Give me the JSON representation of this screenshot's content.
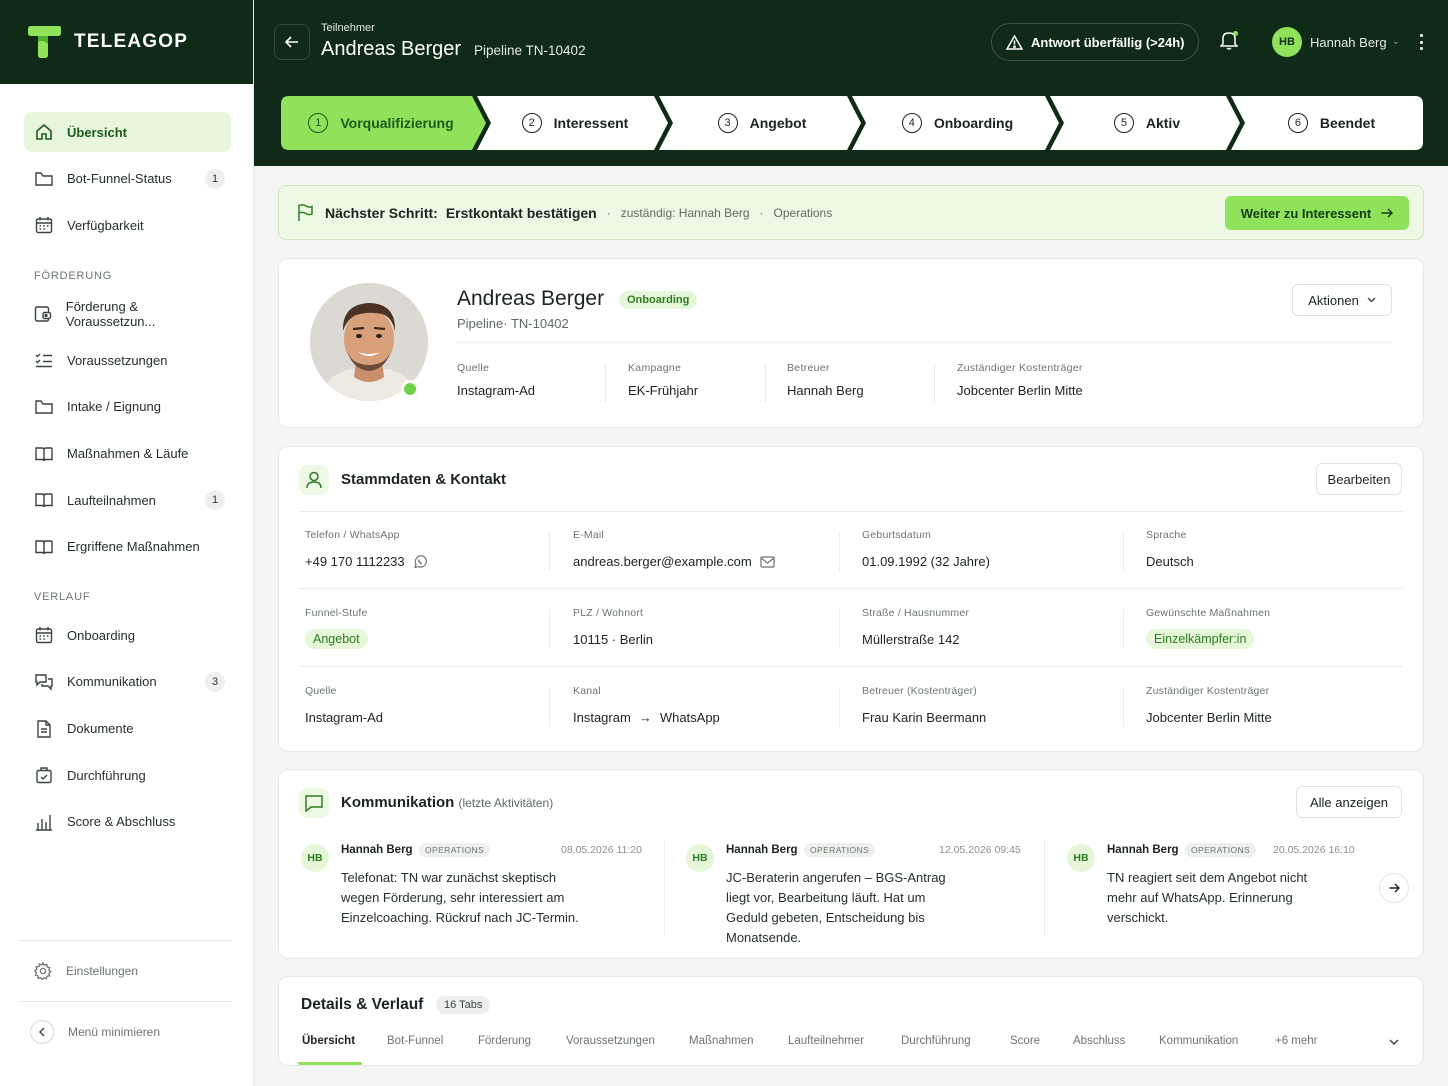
{
  "brand": {
    "name": "TELEAGOP"
  },
  "sidebar": {
    "items": [
      {
        "label": "Übersicht",
        "icon": "home-icon",
        "active": true
      },
      {
        "label": "Bot-Funnel-Status",
        "icon": "folder-icon",
        "count": "1"
      },
      {
        "label": "Verfügbarkeit",
        "icon": "calendar-icon"
      }
    ],
    "section_foerderung": "FÖRDERUNG",
    "foerderung_items": [
      {
        "label": "Förderung & Voraussetzun...",
        "icon": "wallet-icon"
      },
      {
        "label": "Voraussetzungen",
        "icon": "checklist-icon"
      },
      {
        "label": "Intake / Eignung",
        "icon": "folder-icon"
      },
      {
        "label": "Maßnahmen & Läufe",
        "icon": "book-icon"
      },
      {
        "label": "Laufteilnahmen",
        "icon": "book-icon",
        "count": "1"
      },
      {
        "label": "Ergriffene Maßnahmen",
        "icon": "book-icon"
      }
    ],
    "section_verlauf": "VERLAUF",
    "verlauf_items": [
      {
        "label": "Onboarding",
        "icon": "calendar-icon"
      },
      {
        "label": "Kommunikation",
        "icon": "chat-icon",
        "count": "3"
      },
      {
        "label": "Dokumente",
        "icon": "document-icon"
      },
      {
        "label": "Durchführung",
        "icon": "briefcase-icon"
      },
      {
        "label": "Score & Abschluss",
        "icon": "bar-chart-icon"
      }
    ],
    "settings": "Einstellungen",
    "minimize": "Menü minimieren"
  },
  "header": {
    "small_label": "Teilnehmer",
    "name": "Andreas Berger",
    "pipeline": "Pipeline TN-10402",
    "alert": "Antwort überfällig (>24h)",
    "user_initials": "HB",
    "user_name": "Hannah Berg"
  },
  "stepper": [
    {
      "num": "1",
      "label": "Vorqualifizierung",
      "active": true
    },
    {
      "num": "2",
      "label": "Interessent"
    },
    {
      "num": "3",
      "label": "Angebot"
    },
    {
      "num": "4",
      "label": "Onboarding"
    },
    {
      "num": "5",
      "label": "Aktiv"
    },
    {
      "num": "6",
      "label": "Beendet"
    }
  ],
  "next_step": {
    "label": "Nächster Schritt:",
    "value": "Erstkontakt bestätigen",
    "owner": "zuständig: Hannah Berg",
    "team": "Operations",
    "button": "Weiter zu Interessent"
  },
  "profile": {
    "name": "Andreas Berger",
    "badge": "Onboarding",
    "pipeline": "Pipeline· TN-10402",
    "actions": "Aktionen",
    "fields": [
      {
        "key": "Quelle",
        "value": "Instagram-Ad"
      },
      {
        "key": "Kampagne",
        "value": "EK-Frühjahr"
      },
      {
        "key": "Betreuer",
        "value": "Hannah Berg"
      },
      {
        "key": "Zuständiger Kostenträger",
        "value": "Jobcenter Berlin Mitte"
      }
    ]
  },
  "stammdaten": {
    "title": "Stammdaten & Kontakt",
    "edit": "Bearbeiten",
    "rows": [
      [
        {
          "key": "Telefon / WhatsApp",
          "value": "+49 170 1112233"
        },
        {
          "key": "E-Mail",
          "value": "andreas.berger@example.com"
        },
        {
          "key": "Geburtsdatum",
          "value": "01.09.1992 (32 Jahre)"
        },
        {
          "key": "Sprache",
          "value": "Deutsch"
        }
      ],
      [
        {
          "key": "Funnel-Stufe",
          "value": "Angebot"
        },
        {
          "key": "PLZ / Wohnort",
          "value": "10115 · Berlin"
        },
        {
          "key": "Straße / Hausnummer",
          "value": "Müllerstraße 142"
        },
        {
          "key": "Gewünschte Maßnahmen",
          "value": "Einzelkämpfer:in"
        }
      ],
      [
        {
          "key": "Quelle",
          "value": "Instagram-Ad"
        },
        {
          "key": "Kanal",
          "value_from": "Instagram",
          "value_arrow": "→",
          "value_to": "WhatsApp"
        },
        {
          "key": "Betreuer (Kostenträger)",
          "value": "Frau Karin Beermann"
        },
        {
          "key": "Zuständiger Kostenträger",
          "value": "Jobcenter Berlin Mitte"
        }
      ]
    ]
  },
  "kommunikation": {
    "title": "Kommunikation",
    "subtitle": "(letzte Aktivitäten)",
    "show_all": "Alle anzeigen",
    "messages": [
      {
        "initials": "HB",
        "name": "Hannah Berg",
        "tag": "OPERATIONS",
        "time": "08.05.2026 11:20",
        "text": "Telefonat: TN war zunächst skeptisch wegen Förderung, sehr interessiert am Einzelcoaching. Rückruf nach JC-Termin."
      },
      {
        "initials": "HB",
        "name": "Hannah Berg",
        "tag": "OPERATIONS",
        "time": "12.05.2026 09:45",
        "text": "JC-Beraterin angerufen – BGS-Antrag liegt vor, Bearbeitung läuft. Hat um Geduld gebeten, Entscheidung bis Monatsende."
      },
      {
        "initials": "HB",
        "name": "Hannah Berg",
        "tag": "OPERATIONS",
        "time": "20.05.2026 16:10",
        "text": "TN reagiert seit dem Angebot nicht mehr auf WhatsApp. Erinnerung verschickt."
      }
    ]
  },
  "details": {
    "title": "Details & Verlauf",
    "badge": "16 Tabs",
    "tabs": [
      "Übersicht",
      "Bot-Funnel",
      "Förderung",
      "Voraussetzungen",
      "Maßnahmen",
      "Laufteilnehmer",
      "Durchführung",
      "Score",
      "Abschluss",
      "Kommunikation",
      "+6 mehr"
    ]
  },
  "colors": {
    "brand_dark": "#0f2a17",
    "accent_green": "#8fe25a",
    "active_bg": "#e8f7dc"
  }
}
